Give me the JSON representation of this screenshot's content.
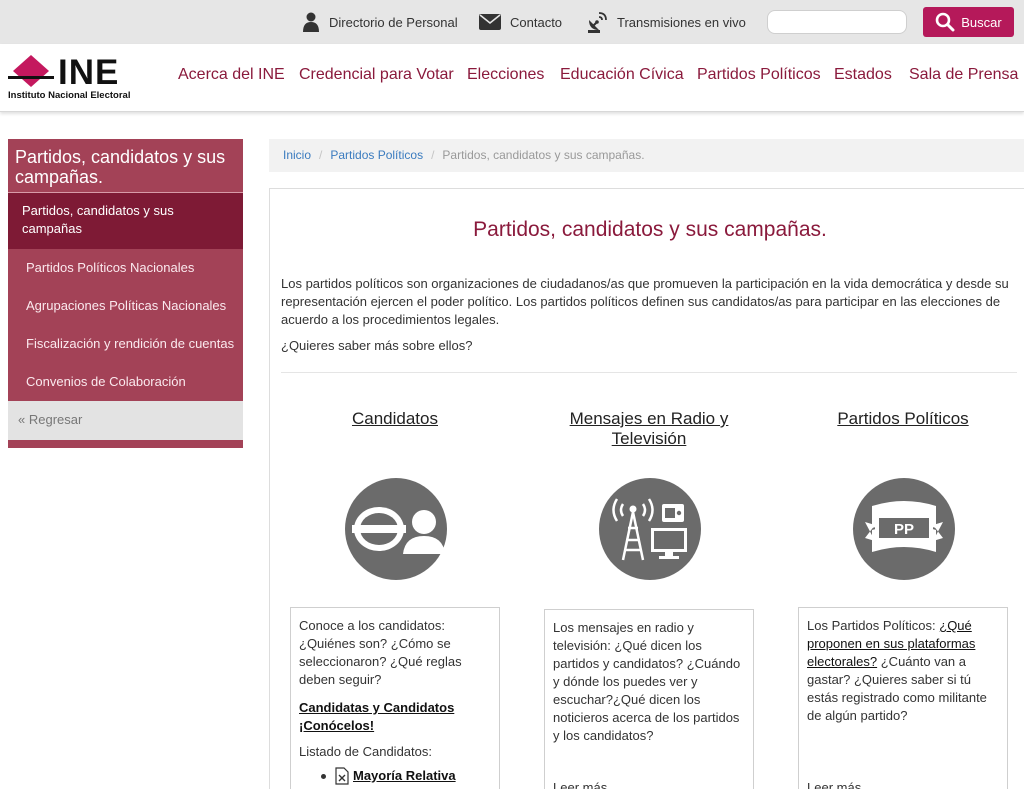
{
  "topbar": {
    "directory_label": "Directorio de Personal",
    "contact_label": "Contacto",
    "broadcast_label": "Transmisiones en vivo",
    "search_value": "",
    "search_button_label": "Buscar"
  },
  "logo": {
    "word": "INE",
    "subtitle": "Instituto Nacional Electoral"
  },
  "nav": [
    "Acerca del INE",
    "Credencial para Votar",
    "Elecciones",
    "Educación Cívica",
    "Partidos Políticos",
    "Estados",
    "Sala de Prensa"
  ],
  "sidebar": {
    "title": "Partidos, candidatos y sus campañas.",
    "active_item": "Partidos, candidatos y sus campañas",
    "items": [
      "Partidos Políticos Nacionales",
      "Agrupaciones Políticas Nacionales",
      "Fiscalización y rendición de cuentas",
      "Convenios de Colaboración"
    ],
    "back_label": "« Regresar"
  },
  "breadcrumb": {
    "home": "Inicio",
    "section": "Partidos Políticos",
    "current": "Partidos, candidatos y sus campañas."
  },
  "main": {
    "title": "Partidos, candidatos y sus campañas.",
    "intro": "Los partidos políticos son organizaciones de ciudadanos/as que promueven la participación en la vida democrática y desde su representación ejercen el poder político. Los partidos políticos definen sus candidatos/as para participar en las elecciones de acuerdo a los procedimientos legales.",
    "question": "¿Quieres saber más sobre ellos?"
  },
  "columns": {
    "candidates": {
      "title": "Candidatos",
      "text": "Conoce a los candidatos: ¿Quiénes son? ¿Cómo se seleccionaron? ¿Qué reglas deben seguir?",
      "link_line1": "Candidatas y Candidatos",
      "link_line2": "¡Conócelos!",
      "list_label": "Listado de Candidatos:",
      "list_item": "Mayoría Relativa"
    },
    "media": {
      "title": "Mensajes en Radio y Televisión",
      "text": "Los mensajes en radio y televisión: ¿Qué dicen los partidos y candidatos? ¿Cuándo y dónde los puedes ver y escuchar?¿Qué dicen los noticieros acerca de los partidos y los candidatos?",
      "more": "Leer más..."
    },
    "parties": {
      "title": "Partidos Políticos",
      "text_before": "Los Partidos Políticos:",
      "link": "¿Qué proponen en sus plataformas electorales?",
      "text_after": "¿Cuánto van a gastar? ¿Quieres saber si tú estás registrado como militante de algún partido?",
      "more": "Leer más...",
      "icon_text": "PP"
    }
  },
  "colors": {
    "brand": "#b5195a",
    "nav_text": "#8a1a3c",
    "sidebar_bg": "#a34257",
    "sidebar_active": "#7e1a35",
    "icon_circle": "#6b6b6b"
  }
}
